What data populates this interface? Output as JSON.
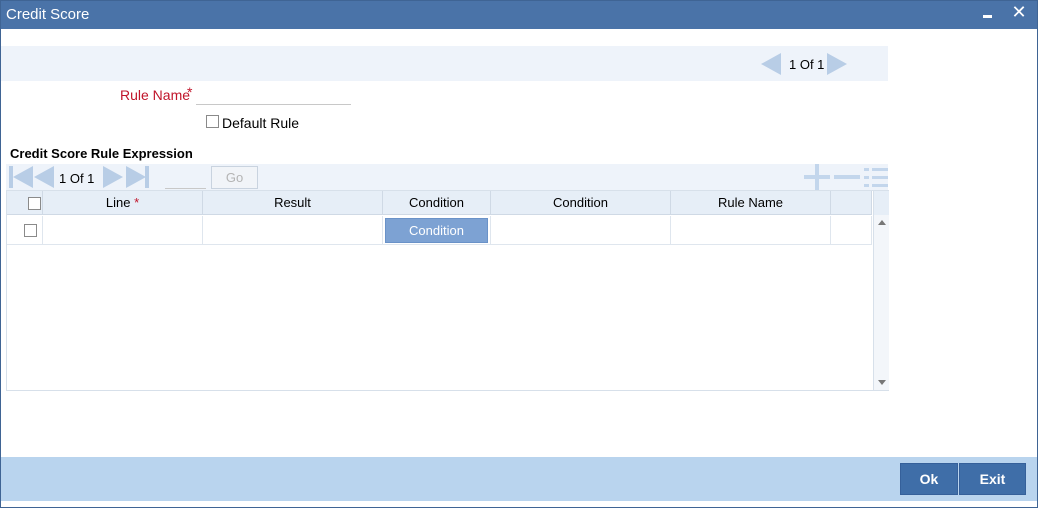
{
  "window": {
    "title": "Credit Score",
    "minimize_icon": "minimize-icon",
    "close_glyph": "✕"
  },
  "record_nav": {
    "page_text": "1 Of 1"
  },
  "form": {
    "rule_name_label": "Rule Name",
    "required_mark": "*",
    "rule_name_value": "",
    "default_rule_label": "Default Rule",
    "default_rule_checked": false
  },
  "section": {
    "title": "Credit Score Rule Expression"
  },
  "grid": {
    "page_text": "1 Of 1",
    "goto_value": "",
    "go_label": "Go",
    "columns": [
      {
        "label": "Line",
        "required": true
      },
      {
        "label": "Result",
        "required": false
      },
      {
        "label": "Condition",
        "required": false
      },
      {
        "label": "Condition",
        "required": false
      },
      {
        "label": "Rule Name",
        "required": false
      }
    ],
    "rows": [
      {
        "line": "",
        "result": "",
        "condition_button": "Condition",
        "condition": "",
        "rule_name": ""
      }
    ]
  },
  "footer": {
    "ok_label": "Ok",
    "exit_label": "Exit"
  },
  "colors": {
    "titlebar": "#4a73a8",
    "footer": "#b9d4ee",
    "button": "#3f6ea8",
    "required": "#c0142a"
  }
}
